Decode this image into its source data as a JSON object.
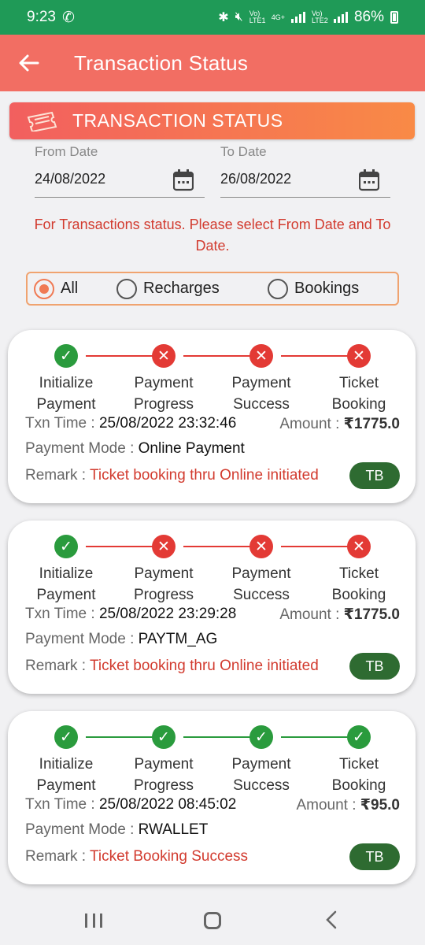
{
  "status_bar": {
    "time": "9:23",
    "network_labels": [
      "Vo) LTE1",
      "4G+",
      "Vo) LTE2"
    ],
    "battery_pct": "86%"
  },
  "app_bar": {
    "title": "Transaction Status"
  },
  "section": {
    "title": "TRANSACTION STATUS"
  },
  "filters": {
    "from_label": "From Date",
    "from_value": "24/08/2022",
    "to_label": "To Date",
    "to_value": "26/08/2022",
    "hint": "For Transactions status. Please select From Date and To Date.",
    "options": [
      {
        "label": "All",
        "selected": true
      },
      {
        "label": "Recharges",
        "selected": false
      },
      {
        "label": "Bookings",
        "selected": false
      }
    ]
  },
  "labels": {
    "txn_time": "Txn Time : ",
    "amount": "Amount : ",
    "payment_mode": "Payment Mode : ",
    "remark": "Remark : "
  },
  "colors": {
    "ok": "#2a9b3d",
    "fail": "#e33a35",
    "accent": "#f26e63"
  },
  "transactions": [
    {
      "steps": [
        {
          "line1": "Initialize",
          "line2": "Payment",
          "status": "ok"
        },
        {
          "line1": "Payment",
          "line2": "Progress",
          "status": "fail"
        },
        {
          "line1": "Payment",
          "line2": "Success",
          "status": "fail"
        },
        {
          "line1": "Ticket",
          "line2": "Booking",
          "status": "fail"
        }
      ],
      "txn_time": "25/08/2022 23:32:46",
      "amount": "₹1775.0",
      "payment_mode": "Online Payment",
      "remark": "Ticket booking thru Online initiated",
      "badge": "TB"
    },
    {
      "steps": [
        {
          "line1": "Initialize",
          "line2": "Payment",
          "status": "ok"
        },
        {
          "line1": "Payment",
          "line2": "Progress",
          "status": "fail"
        },
        {
          "line1": "Payment",
          "line2": "Success",
          "status": "fail"
        },
        {
          "line1": "Ticket",
          "line2": "Booking",
          "status": "fail"
        }
      ],
      "txn_time": "25/08/2022 23:29:28",
      "amount": "₹1775.0",
      "payment_mode": "PAYTM_AG",
      "remark": "Ticket booking thru Online initiated",
      "badge": "TB"
    },
    {
      "steps": [
        {
          "line1": "Initialize",
          "line2": "Payment",
          "status": "ok"
        },
        {
          "line1": "Payment",
          "line2": "Progress",
          "status": "ok"
        },
        {
          "line1": "Payment",
          "line2": "Success",
          "status": "ok"
        },
        {
          "line1": "Ticket",
          "line2": "Booking",
          "status": "ok"
        }
      ],
      "txn_time": "25/08/2022 08:45:02",
      "amount": "₹95.0",
      "payment_mode": "RWALLET",
      "remark": "Ticket Booking Success",
      "badge": "TB"
    }
  ]
}
